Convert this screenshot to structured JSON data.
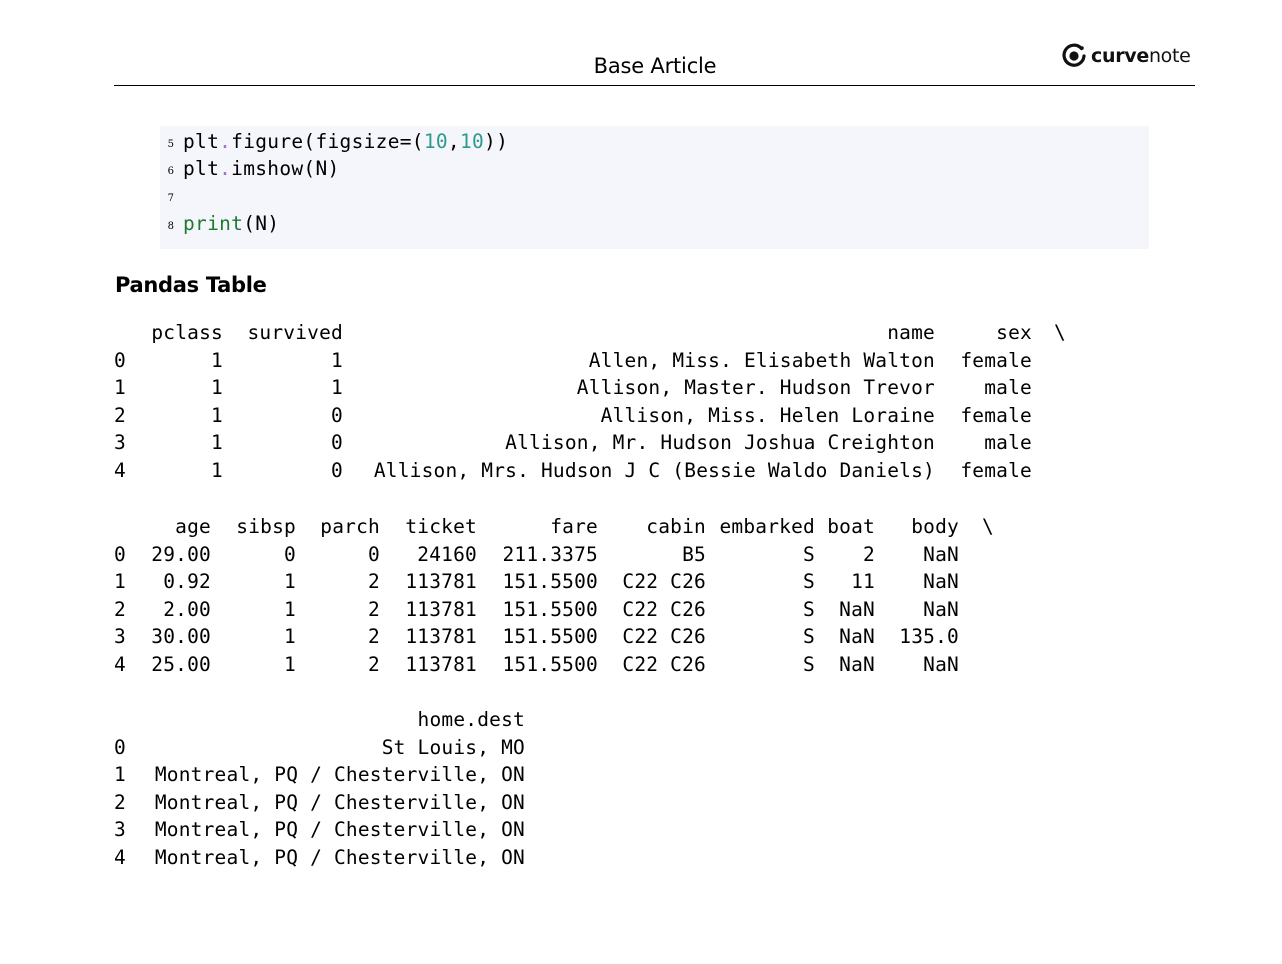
{
  "header": {
    "title": "Base Article",
    "brand_bold": "curve",
    "brand_regular": "note",
    "brand_icon": "curvenote-logo-icon"
  },
  "code": [
    {
      "n": "5",
      "tokens": [
        {
          "t": "plt",
          "c": ""
        },
        {
          "t": ".",
          "c": "dot"
        },
        {
          "t": "figure(figsize=(",
          "c": ""
        },
        {
          "t": "10",
          "c": "num"
        },
        {
          "t": ",",
          "c": ""
        },
        {
          "t": "10",
          "c": "num"
        },
        {
          "t": "))",
          "c": ""
        }
      ]
    },
    {
      "n": "6",
      "tokens": [
        {
          "t": "plt",
          "c": ""
        },
        {
          "t": ".",
          "c": "dot"
        },
        {
          "t": "imshow(N)",
          "c": ""
        }
      ]
    },
    {
      "n": "7",
      "tokens": []
    },
    {
      "n": "8",
      "tokens": [
        {
          "t": "print",
          "c": "kw"
        },
        {
          "t": "(N)",
          "c": ""
        }
      ]
    }
  ],
  "section": {
    "heading": "Pandas Table"
  },
  "tables": [
    {
      "headers": [
        "",
        "pclass",
        "survived",
        "name",
        "sex",
        "\\"
      ],
      "rows": [
        [
          "0",
          "1",
          "1",
          "Allen, Miss. Elisabeth Walton",
          "female"
        ],
        [
          "1",
          "1",
          "1",
          "Allison, Master. Hudson Trevor",
          "male"
        ],
        [
          "2",
          "1",
          "0",
          "Allison, Miss. Helen Loraine",
          "female"
        ],
        [
          "3",
          "1",
          "0",
          "Allison, Mr. Hudson Joshua Creighton",
          "male"
        ],
        [
          "4",
          "1",
          "0",
          "Allison, Mrs. Hudson J C (Bessie Waldo Daniels)",
          "female"
        ]
      ]
    },
    {
      "headers": [
        "",
        "age",
        "sibsp",
        "parch",
        "ticket",
        "fare",
        "cabin",
        "embarked",
        "boat",
        "body",
        "\\"
      ],
      "rows": [
        [
          "0",
          "29.00",
          "0",
          "0",
          "24160",
          "211.3375",
          "B5",
          "S",
          "2",
          "NaN"
        ],
        [
          "1",
          "0.92",
          "1",
          "2",
          "113781",
          "151.5500",
          "C22 C26",
          "S",
          "11",
          "NaN"
        ],
        [
          "2",
          "2.00",
          "1",
          "2",
          "113781",
          "151.5500",
          "C22 C26",
          "S",
          "NaN",
          "NaN"
        ],
        [
          "3",
          "30.00",
          "1",
          "2",
          "113781",
          "151.5500",
          "C22 C26",
          "S",
          "NaN",
          "135.0"
        ],
        [
          "4",
          "25.00",
          "1",
          "2",
          "113781",
          "151.5500",
          "C22 C26",
          "S",
          "NaN",
          "NaN"
        ]
      ]
    },
    {
      "headers": [
        "",
        "home.dest"
      ],
      "rows": [
        [
          "0",
          "St Louis, MO"
        ],
        [
          "1",
          "Montreal, PQ / Chesterville, ON"
        ],
        [
          "2",
          "Montreal, PQ / Chesterville, ON"
        ],
        [
          "3",
          "Montreal, PQ / Chesterville, ON"
        ],
        [
          "4",
          "Montreal, PQ / Chesterville, ON"
        ]
      ]
    }
  ]
}
